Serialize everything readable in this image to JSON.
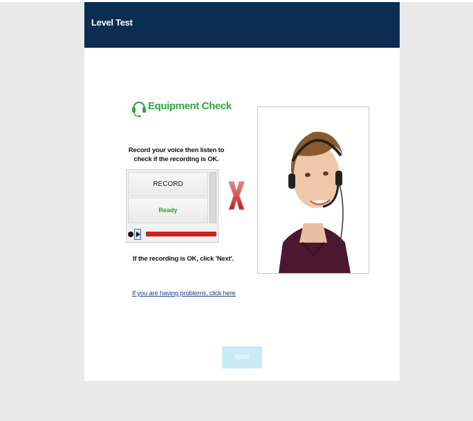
{
  "app": {
    "title": "Level Test"
  },
  "equipment_check": {
    "title": "Equipment Check",
    "instructions": "Record your voice then listen to check if the recording is OK.",
    "recorder": {
      "record_label": "RECORD",
      "status": "Ready",
      "status_color": "#21a32d",
      "progress_color": "#d21f1f"
    },
    "status_mark": "x-mark-icon",
    "ok_hint": "If the recording is OK, click 'Next'.",
    "problems_link": "If you are having problems, click here"
  },
  "photo": {
    "subject": "person-with-headset"
  },
  "footer": {
    "next_label": "Next"
  },
  "colors": {
    "header": "#0b2d52",
    "accent_green": "#2fa83e",
    "next_button": "#c9eaf7"
  }
}
